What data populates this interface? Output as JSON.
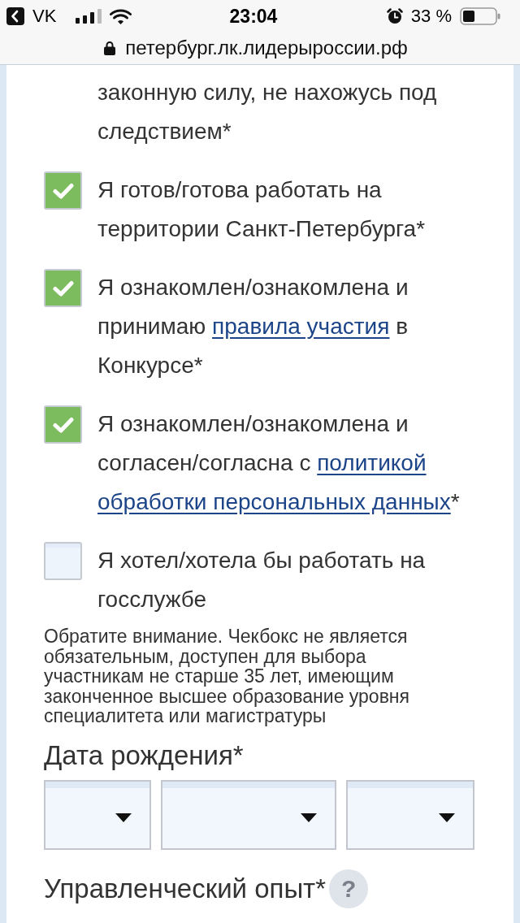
{
  "status_bar": {
    "back_label": "VK",
    "time": "23:04",
    "battery": "33 %"
  },
  "address_bar": {
    "url": "петербург.лк.лидерыроссии.рф"
  },
  "consents": [
    {
      "kind": "text",
      "parts": [
        {
          "text": "законную силу, не нахожусь под следствием*"
        }
      ]
    },
    {
      "kind": "checkbox",
      "checked": true,
      "parts": [
        {
          "text": "Я готов/готова работать на территории Санкт-Петербурга*"
        }
      ]
    },
    {
      "kind": "checkbox",
      "checked": true,
      "parts": [
        {
          "text": "Я ознакомлен/ознакомлена и принимаю "
        },
        {
          "text": "правила участия",
          "link": true
        },
        {
          "text": " в Конкурсе*"
        }
      ]
    },
    {
      "kind": "checkbox",
      "checked": true,
      "parts": [
        {
          "text": "Я ознакомлен/ознакомлена и согласен/согласна с "
        },
        {
          "text": "политикой ",
          "link": true
        },
        {
          "text": "обработки персональных данных",
          "link": true
        },
        {
          "text": "*"
        }
      ]
    },
    {
      "kind": "checkbox",
      "checked": false,
      "parts": [
        {
          "text": "Я хотел/хотела бы работать на госслужбе"
        }
      ]
    }
  ],
  "note": "Обратите внимание. Чекбокс не является обязательным, доступен для выбора участникам не старше 35 лет, имеющим законченное высшее образование уровня специалитета или магистратуры",
  "birth_date": {
    "label": "Дата рождения*",
    "selects": [
      {
        "kind": "dropdown"
      },
      {
        "kind": "dropdown"
      },
      {
        "kind": "dropdown"
      }
    ]
  },
  "experience": {
    "label": "Управленческий опыт*",
    "help": "?"
  }
}
